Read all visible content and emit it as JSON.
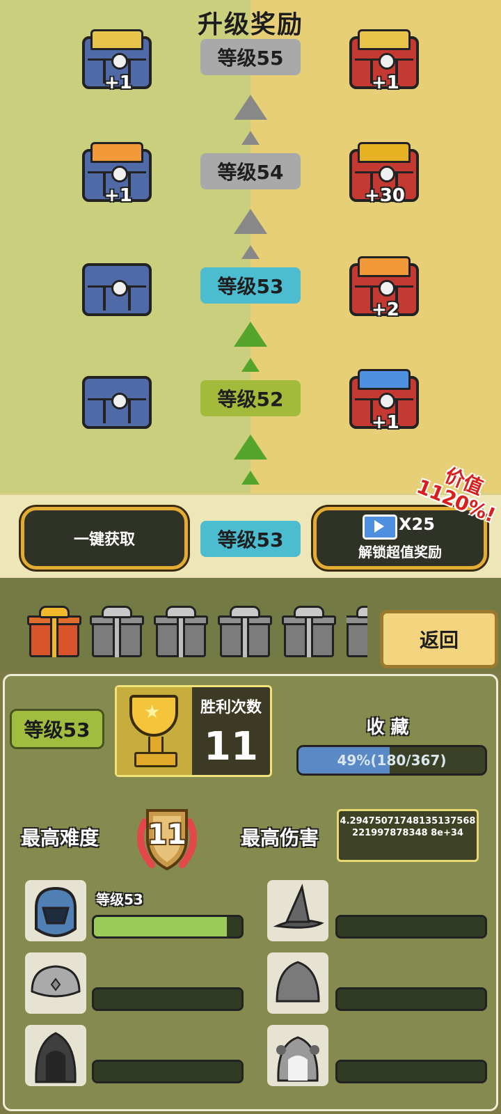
{
  "reward_panel": {
    "title": "升级奖励",
    "rows": [
      {
        "level": "等级55",
        "state": "locked",
        "free": {
          "content": "cards",
          "amount": "+1"
        },
        "premium": {
          "content": "cards",
          "amount": "+1"
        }
      },
      {
        "level": "等级54",
        "state": "locked",
        "free": {
          "content": "flame",
          "amount": "+1"
        },
        "premium": {
          "content": "coins",
          "amount": "+30"
        }
      },
      {
        "level": "等级53",
        "state": "current",
        "free": {
          "content": "empty",
          "amount": ""
        },
        "premium": {
          "content": "flame",
          "amount": "+2"
        }
      },
      {
        "level": "等级52",
        "state": "claimed",
        "free": {
          "content": "empty",
          "amount": ""
        },
        "premium": {
          "content": "tickets",
          "amount": "+1"
        }
      }
    ],
    "claim_all_label": "一键获取",
    "current_level": "等级53",
    "unlock_multiplier": "X25",
    "unlock_label": "解锁超值奖励",
    "value_badge": "价值1120%!"
  },
  "gifts": {
    "items": [
      "gold",
      "gray",
      "gray",
      "gray",
      "gray",
      "gray"
    ],
    "return_label": "返回"
  },
  "profile": {
    "level": "等级53",
    "wins_label": "胜利次数",
    "wins_value": "11",
    "collection_label": "收 藏",
    "collection_text": "49%(180/367)",
    "collection_progress": 0.49,
    "difficulty_label": "最高难度",
    "difficulty_value": "11",
    "damage_label": "最高伤害",
    "damage_value": "4.29475071748135137568221997878348 8e+34",
    "heroes": [
      {
        "icon": "blue-helmet-icon",
        "level": "等级53",
        "progress": 0.9
      },
      {
        "icon": "wizard-hat-icon",
        "level": "",
        "progress": 0
      },
      {
        "icon": "turban-icon",
        "level": "",
        "progress": 0
      },
      {
        "icon": "hood-icon",
        "level": "",
        "progress": 0
      },
      {
        "icon": "dark-hood-icon",
        "level": "",
        "progress": 0
      },
      {
        "icon": "leaf-hood-icon",
        "level": "",
        "progress": 0
      }
    ]
  },
  "colors": {
    "free_column": "#c9cf7c",
    "premium_column": "#e6cf77",
    "locked_tag": "#a9a9a9",
    "current_tag": "#4cbcd1",
    "claimed_tag": "#a3ba3b",
    "arrow_locked": "#888888",
    "arrow_unlocked": "#55a52c"
  }
}
